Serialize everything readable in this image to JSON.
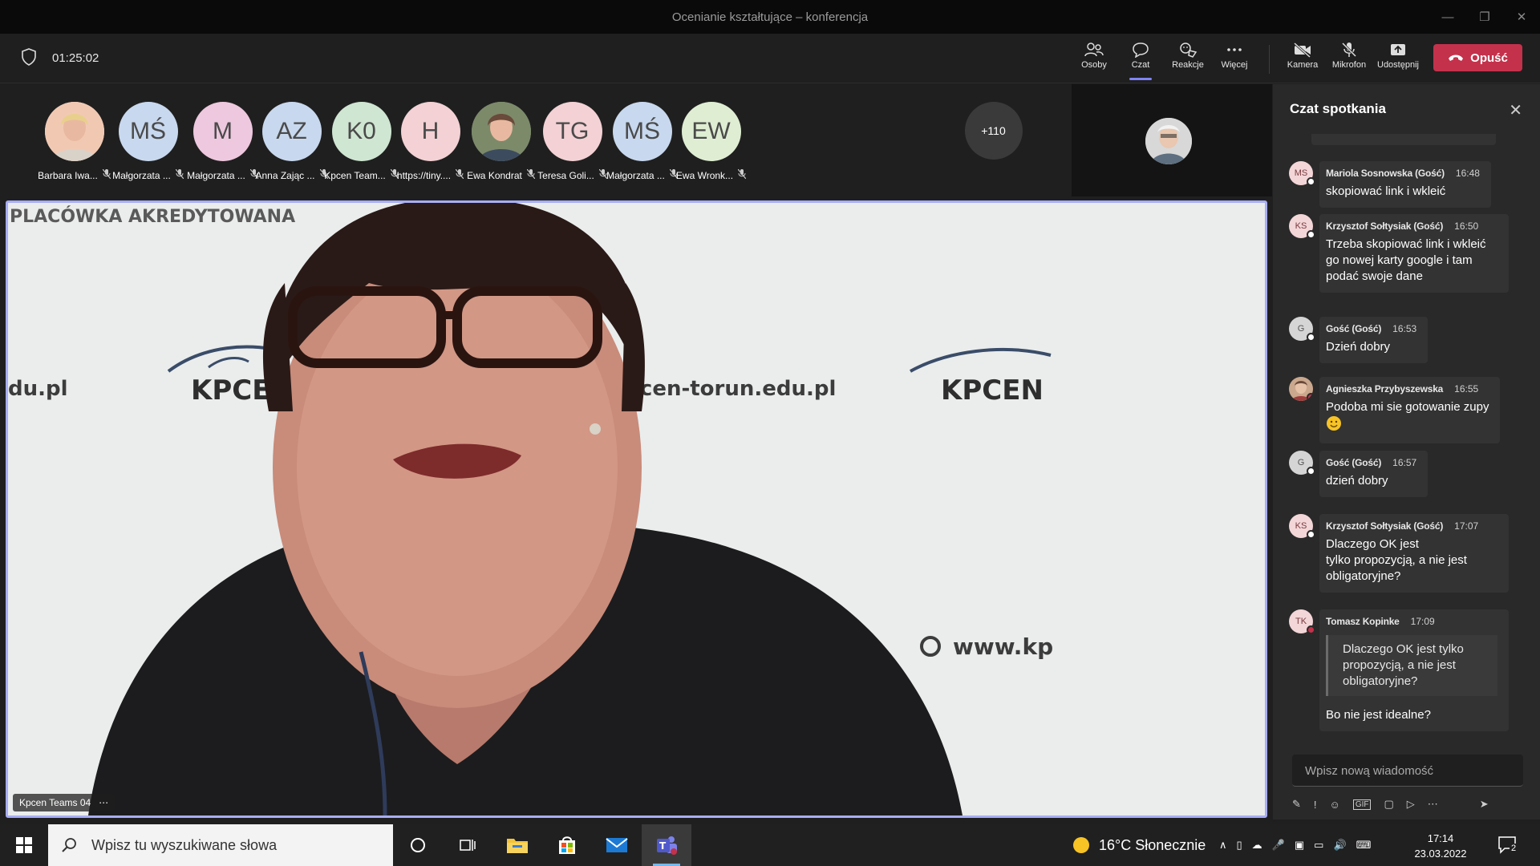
{
  "window": {
    "title": "Ocenianie kształtujące – konferencja"
  },
  "meeting": {
    "timer": "01:25:02"
  },
  "controls": [
    {
      "label": "Osoby",
      "icon": "people-icon"
    },
    {
      "label": "Czat",
      "icon": "chat-icon",
      "active": true
    },
    {
      "label": "Reakcje",
      "icon": "reactions-icon"
    },
    {
      "label": "Więcej",
      "icon": "more-icon"
    },
    {
      "label": "Kamera",
      "icon": "camera-off-icon"
    },
    {
      "label": "Mikrofon",
      "icon": "mic-off-icon"
    },
    {
      "label": "Udostępnij",
      "icon": "share-icon"
    }
  ],
  "leave_label": "Opuść",
  "participants": [
    {
      "name": "Barbara Iwa...",
      "initials": "",
      "photo": true,
      "bg": "#f1c9b3"
    },
    {
      "name": "Małgorzata ...",
      "initials": "MŚ",
      "bg": "#c8d8ee"
    },
    {
      "name": "Małgorzata ...",
      "initials": "M",
      "bg": "#eec8de"
    },
    {
      "name": "Anna Zając ...",
      "initials": "AZ",
      "bg": "#c8d8ee"
    },
    {
      "name": "Kpcen Team...",
      "initials": "K0",
      "bg": "#cfe6d2"
    },
    {
      "name": "https://tiny....",
      "initials": "H",
      "bg": "#f3d1d4"
    },
    {
      "name": "Ewa Kondrat",
      "initials": "",
      "photo": true,
      "bg": "#7c8a6a"
    },
    {
      "name": "Teresa Goli...",
      "initials": "TG",
      "bg": "#f3d1d4"
    },
    {
      "name": "Małgorzata ...",
      "initials": "MŚ",
      "bg": "#c8d8ee"
    },
    {
      "name": "Ewa Wronk...",
      "initials": "EW",
      "bg": "#dfeed3"
    }
  ],
  "overflow_count": "+110",
  "video": {
    "speaker": "Kpcen Teams 04",
    "banner_text": "PLACÓWKA AKREDYTOWANA",
    "logo_text": "KPCEN",
    "url_text": "kpcen-torun.edu.pl",
    "url_left": "du.pl",
    "www_text": "www.kp"
  },
  "chat": {
    "title": "Czat spotkania",
    "messages": [
      {
        "initials": "MS",
        "author": "Mariola Sosnowska (Gość)",
        "time": "16:48",
        "text": "skopiować link i wkleić"
      },
      {
        "initials": "KS",
        "author": "Krzysztof Sołtysiak (Gość)",
        "time": "16:50",
        "text": "Trzeba skopiować link i wkleić go nowej karty google i tam podać swoje dane"
      },
      {
        "initials": "G",
        "author": "Gość (Gość)",
        "time": "16:53",
        "text": "Dzień dobry"
      },
      {
        "initials": "",
        "author": "Agnieszka Przybyszewska",
        "time": "16:55",
        "text": "Podoba mi sie gotowanie zupy"
      },
      {
        "initials": "G",
        "author": "Gość (Gość)",
        "time": "16:57",
        "text": "dzień dobry"
      },
      {
        "initials": "KS",
        "author": "Krzysztof Sołtysiak (Gość)",
        "time": "17:07",
        "text_lines": [
          "Dlaczego OK jest",
          "tylko propozycją, a nie jest obligatoryjne?"
        ]
      },
      {
        "initials": "TK",
        "author": "Tomasz Kopinke",
        "time": "17:09",
        "quote": "Dlaczego OK jest tylko propozycją, a nie jest obligatoryjne?",
        "text": "Bo nie jest idealne?"
      }
    ],
    "composer_placeholder": "Wpisz nową wiadomość"
  },
  "taskbar": {
    "search_placeholder": "Wpisz tu wyszukiwane słowa",
    "weather": "16°C  Słonecznie",
    "time": "17:14",
    "date": "23.03.2022",
    "notifications": "2"
  }
}
